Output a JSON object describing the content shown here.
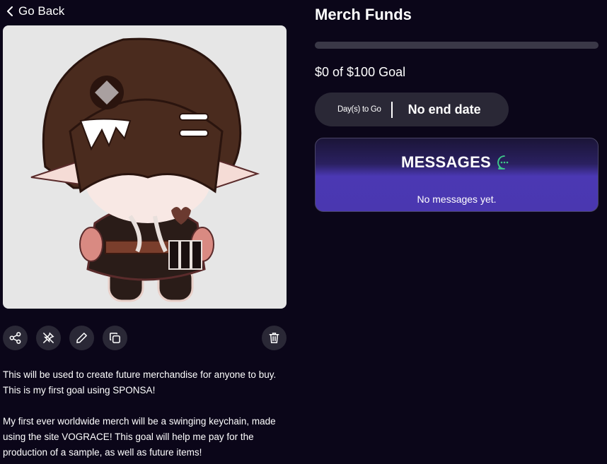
{
  "nav": {
    "back_label": "Go Back"
  },
  "goal": {
    "title": "Merch Funds",
    "raised_text": "$0 of $100 Goal",
    "progress_fraction": 0,
    "days_label": "Day(s) to Go",
    "days_value": "No end date"
  },
  "messages": {
    "title": "MESSAGES",
    "empty_text": "No messages yet.",
    "icon": "chat-bubble-icon",
    "icon_color": "#3ec98a"
  },
  "actions": {
    "icons": [
      "share-icon",
      "unpin-icon",
      "edit-icon",
      "duplicate-icon",
      "delete-icon"
    ]
  },
  "description": {
    "line1": "This will be used to create future merchandise for anyone to buy.",
    "line2": "This is my first goal using SPONSA!",
    "line3": "My first ever worldwide merch will be a swinging keychain, made",
    "line4": "using the site VOGRACE! This goal will help me pay for the",
    "line5": "production of a sample, as well as future items!"
  },
  "colors": {
    "background": "#0b0619",
    "card": "#2a2836",
    "messages_gradient_end": "#4a37b0"
  }
}
